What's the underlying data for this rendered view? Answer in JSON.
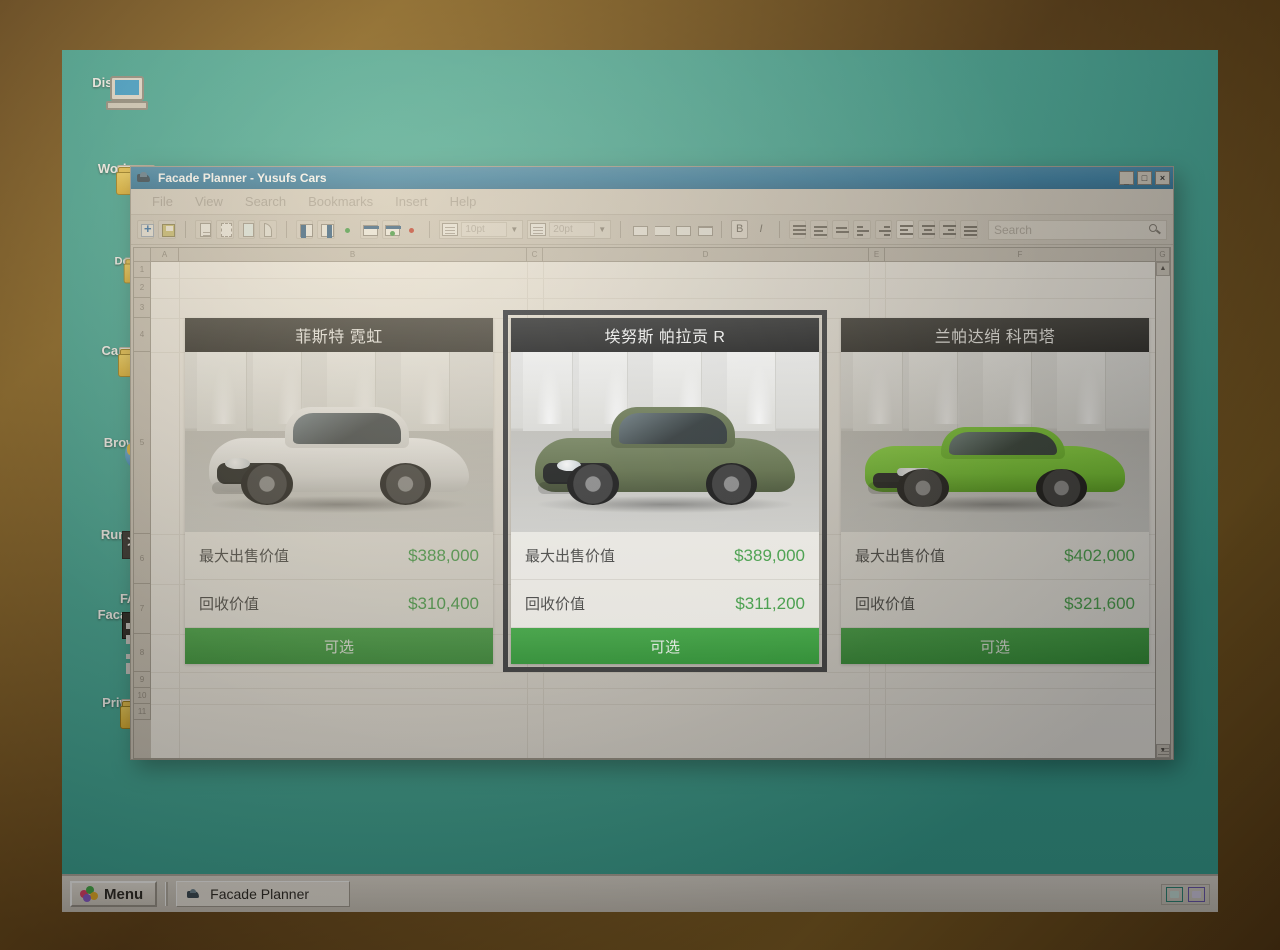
{
  "desktop": {
    "background_color": "#3aa898",
    "icons": [
      {
        "label": "Disk",
        "icon": "computer-icon",
        "type": "computer"
      },
      {
        "label": "Work",
        "icon": "folder-icon",
        "type": "folder"
      },
      {
        "label": "Do",
        "icon": "folder-icon",
        "type": "folder"
      },
      {
        "label": "Cars",
        "icon": "folder-icon",
        "type": "folder"
      },
      {
        "label": "Brow",
        "icon": "globe-icon",
        "type": "globe"
      },
      {
        "label": "Run.C",
        "icon": "terminal-icon",
        "type": "terminal",
        "glyph": ">_"
      },
      {
        "label": "Facade",
        "icon": "facade-app-icon",
        "type": "app",
        "glyph": "FAC"
      },
      {
        "label": "Priva",
        "icon": "folder-icon",
        "type": "folder"
      }
    ]
  },
  "window": {
    "title": "Facade Planner - Yusufs Cars",
    "titlebar_color": "#2e7ba6",
    "icon": "facade-planner-icon",
    "controls": {
      "minimize": "_",
      "maximize": "□",
      "close": "×"
    },
    "menu": [
      "File",
      "View",
      "Search",
      "Bookmarks",
      "Insert",
      "Help"
    ],
    "toolbar": {
      "bold_label": "B",
      "italic_label": "I",
      "font_value": "10pt",
      "size_value": "20pt",
      "buttons": [
        "new-icon",
        "save-icon",
        "document-icon",
        "copy-icon",
        "paste-icon",
        "cut-icon",
        "insert-column-left-icon",
        "insert-column-right-icon",
        "add-column-icon",
        "insert-row-above-icon",
        "insert-row-below-icon",
        "delete-row-icon",
        "merge-cells-icon",
        "split-cells-icon",
        "cell-borders-icon",
        "cell-width-icon"
      ]
    },
    "search": {
      "placeholder": "Search",
      "value": "",
      "icon": "search-icon"
    }
  },
  "sheet": {
    "columns": [
      "A",
      "B",
      "C",
      "D",
      "E",
      "F",
      "G"
    ],
    "rows": [
      "1",
      "2",
      "3",
      "4",
      "5",
      "6",
      "7",
      "8",
      "9",
      "10",
      "11"
    ],
    "scrollbar": {
      "up": "▲",
      "down": "▼"
    }
  },
  "cards": [
    {
      "title": "菲斯特 霓虹",
      "selected": false,
      "car_color": "#f3f2ef",
      "car_accent": "#d9d8d4",
      "stats": [
        {
          "key": "最大出售价值",
          "value": "$388,000"
        },
        {
          "key": "回收价值",
          "value": "$310,400"
        }
      ],
      "button_label": "可选"
    },
    {
      "title": "埃努斯 帕拉贡 R",
      "selected": true,
      "car_color": "#63724c",
      "car_accent": "#4d5b3b",
      "stats": [
        {
          "key": "最大出售价值",
          "value": "$389,000"
        },
        {
          "key": "回收价值",
          "value": "$311,200"
        }
      ],
      "button_label": "可选"
    },
    {
      "title": "兰帕达绡 科西塔",
      "selected": false,
      "car_color": "#74c92e",
      "car_accent": "#5aa71f",
      "stats": [
        {
          "key": "最大出售价值",
          "value": "$402,000"
        },
        {
          "key": "回收价值",
          "value": "$321,600"
        }
      ],
      "button_label": "可选"
    }
  ],
  "colors": {
    "accent_green": "#4aa84f",
    "button_green": "#3ba141",
    "desktop_teal": "#3aa898",
    "title_blue": "#2e7ba6",
    "card_header": "#2f2f2e"
  },
  "taskbar": {
    "menu_label": "Menu",
    "menu_icon": "start-menu-icon",
    "tasks": [
      {
        "label": "Facade Planner",
        "icon": "facade-planner-icon",
        "active": true
      }
    ],
    "tray": [
      "network-tray-icon",
      "display-tray-icon"
    ]
  }
}
